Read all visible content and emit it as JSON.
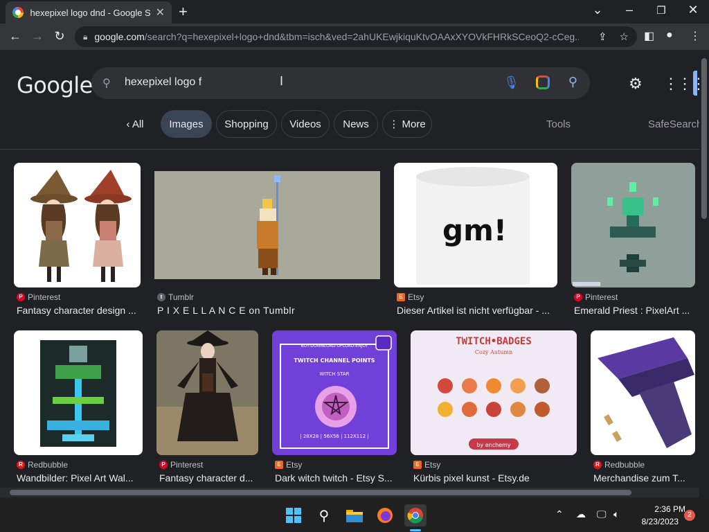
{
  "browser": {
    "tab_title": "hexepixel logo dnd - Google Search",
    "tab_close": "✕",
    "new_tab": "+",
    "win_min": "–",
    "win_restore": "❐",
    "win_close": "✕",
    "win_menu": "⌄",
    "url_host": "google.com",
    "url_path": "/search?q=hexepixel+logo+dnd&tbm=isch&ved=2ahUKEwjkiquKtvOAAxXYOVkFHRkSCeoQ2-cCeg..."
  },
  "google": {
    "logo": "Google",
    "query": "hexepixel logo f",
    "chips": [
      {
        "label": "‹  All"
      },
      {
        "label": "Images"
      },
      {
        "label": "Shopping"
      },
      {
        "label": "Videos"
      },
      {
        "label": "News"
      },
      {
        "label": "⋮ More"
      }
    ],
    "tools": "Tools",
    "safesearch": "SafeSearch"
  },
  "results": [
    {
      "source": "Pinterest",
      "title": "Fantasy character design ...",
      "source_color": "#e60023"
    },
    {
      "source": "Tumblr",
      "title": "P I X E L L A N C E on Tumblr",
      "source_color": "#5f6368"
    },
    {
      "source": "Etsy",
      "title": "Dieser Artikel ist nicht verfügbar - ...",
      "source_color": "#f1641e"
    },
    {
      "source": "Pinterest",
      "title": "Emerald Priest : PixelArt ...",
      "source_color": "#e60023"
    },
    {
      "source": "Redbubble",
      "title": "Wandbilder: Pixel Art Wal...",
      "source_color": "#e41321"
    },
    {
      "source": "Pinterest",
      "title": "Fantasy character d...",
      "source_color": "#e60023"
    },
    {
      "source": "Etsy",
      "title": "Dark witch twitch - Etsy S...",
      "source_color": "#f1641e"
    },
    {
      "source": "Etsy",
      "title": "Kürbis pixel kunst - Etsy.de",
      "source_color": "#f1641e"
    },
    {
      "source": "Redbubble",
      "title": "Merchandise zum T...",
      "source_color": "#e41321"
    }
  ],
  "thumbs": {
    "mug_text": "gm!",
    "twitch_top": "BUY-DOWNLOAD-UPLOAD-ENJOY",
    "twitch_title": "TWITCH CHANNEL POINTS",
    "twitch_sub": "WITCH STAR",
    "twitch_sizes": "| 28X28 | 56X56 | 112X112 |",
    "badges_title": "TWITCH•BADGES",
    "badges_sub": "Cozy Autumn",
    "badges_by": "by enchemy"
  },
  "taskbar": {
    "time": "2:36 PM",
    "date": "8/23/2023",
    "notifications": "2"
  }
}
